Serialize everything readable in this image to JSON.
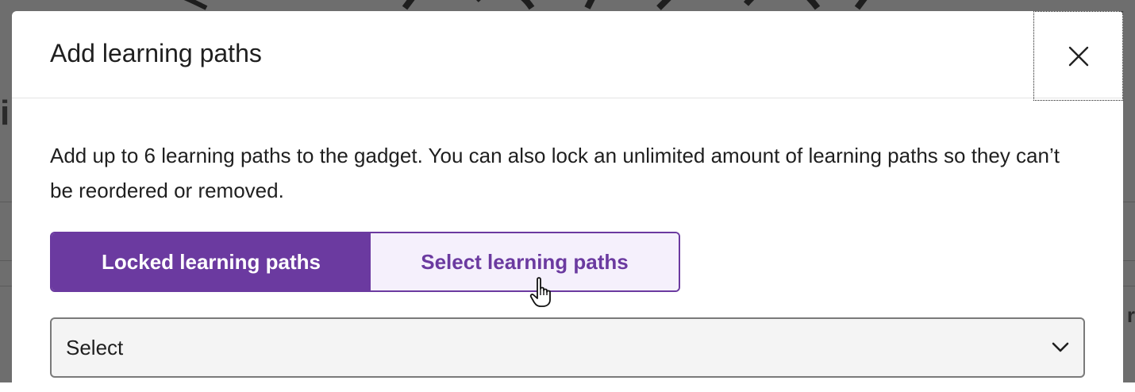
{
  "dialog": {
    "title": "Add learning paths",
    "description": "Add up to 6 learning paths to the gadget. You can also lock an unlimited amount of learning paths so they can’t be reordered or removed.",
    "close_icon": "close-icon"
  },
  "tabs": [
    {
      "label": "Locked learning paths",
      "state": "active"
    },
    {
      "label": "Select learning paths",
      "state": "inactive"
    }
  ],
  "select": {
    "value": "Select",
    "icon": "chevron-down-icon"
  },
  "background": {
    "left_fragment": "i",
    "right_fragment": "r"
  },
  "colors": {
    "accent": "#6b3aa0",
    "accent_light": "#f5f0fc",
    "overlay": "#6e6e6e"
  }
}
